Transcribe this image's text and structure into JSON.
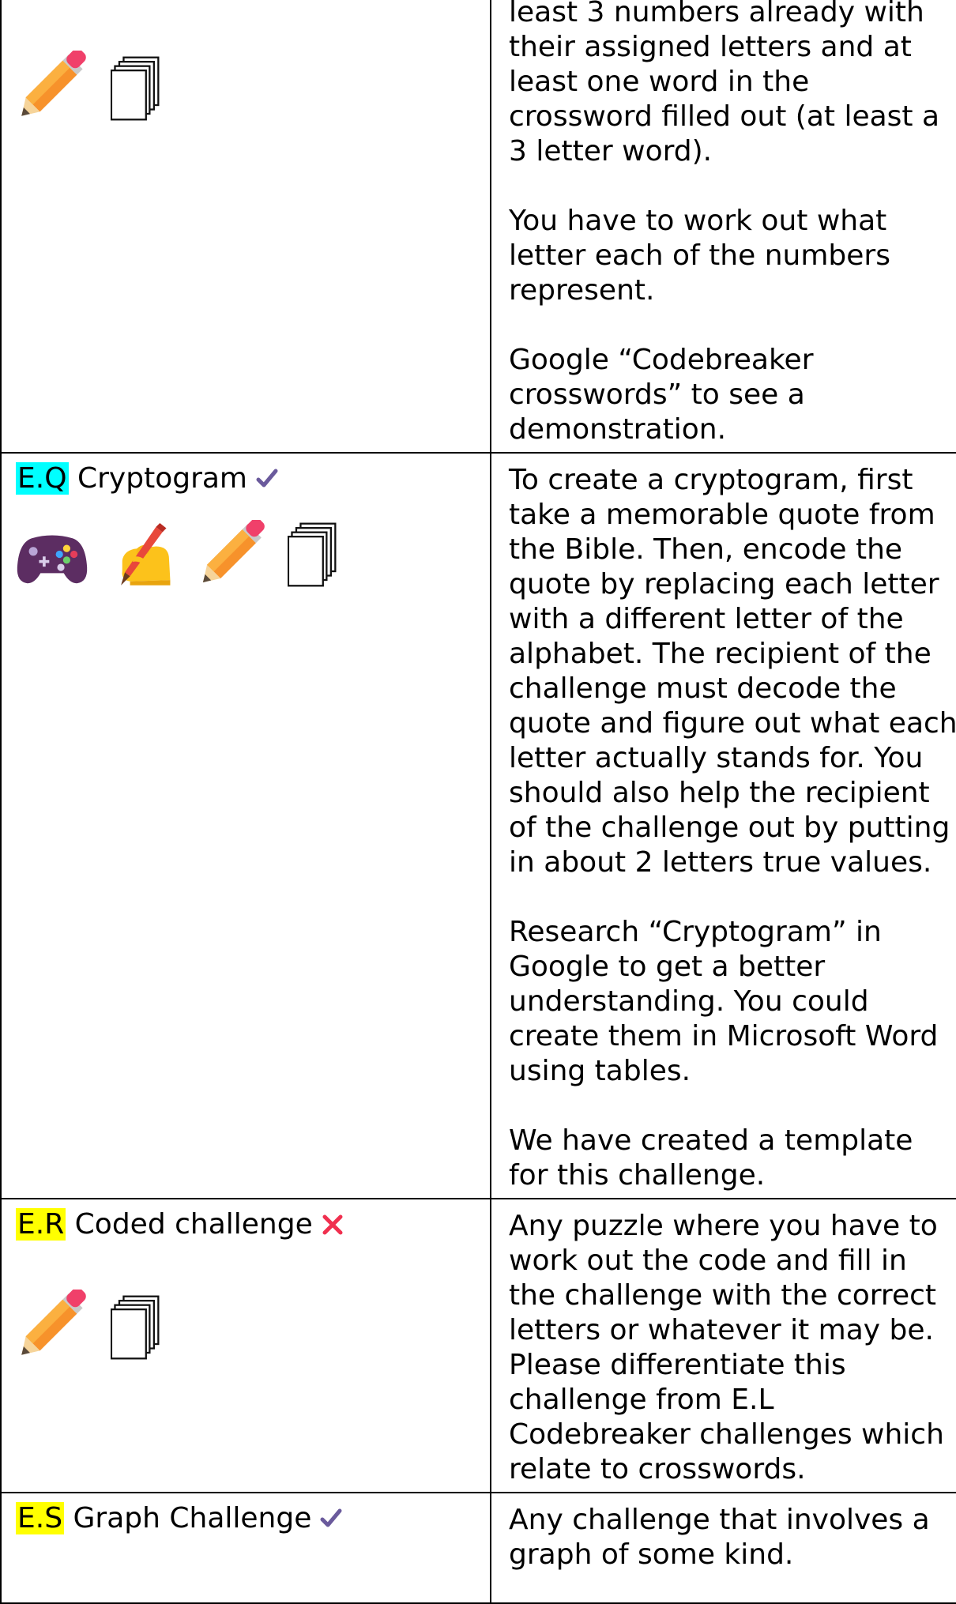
{
  "colors": {
    "highlight_cyan": "#00ffff",
    "highlight_yellow": "#ffff00",
    "check": "#6a5a9c",
    "cross": "#f0304f"
  },
  "rows": [
    {
      "icons": [
        "pencil-icon",
        "documents-icon"
      ],
      "paragraphs": [
        "least 3 numbers already with their assigned letters and at least one word in the crossword filled out (at least a 3 letter word).",
        "You have to work out what letter each of the numbers represent.",
        "Google “Codebreaker crosswords” to see a demonstration."
      ]
    },
    {
      "code": "E.Q",
      "name": "Cryptogram",
      "status": "check-icon",
      "icons": [
        "game-controller-icon",
        "writing-hand-icon",
        "pencil-icon",
        "documents-icon"
      ],
      "paragraphs": [
        "To create a cryptogram, first take a memorable quote from the Bible. Then, encode the quote by replacing each letter with a different letter of the alphabet. The recipient of the challenge must decode the quote and figure out what each letter actually stands for. You should also help the recipient of the challenge out by putting in about 2 letters true values.",
        "Research “Cryptogram” in Google to get a better understanding. You could create them in Microsoft Word using tables.",
        "We have created a template for this challenge."
      ]
    },
    {
      "code": "E.R",
      "name": "Coded challenge",
      "status": "cross-icon",
      "icons": [
        "pencil-icon",
        "documents-icon"
      ],
      "paragraphs": [
        "Any puzzle where you have to work out the code and fill in the challenge with the correct letters or whatever it may be. Please differentiate this challenge from E.L Codebreaker challenges which relate to crosswords."
      ]
    },
    {
      "code": "E.S",
      "name": "Graph Challenge",
      "status": "check-icon",
      "paragraphs": [
        "Any challenge that involves a graph of some kind."
      ]
    }
  ]
}
